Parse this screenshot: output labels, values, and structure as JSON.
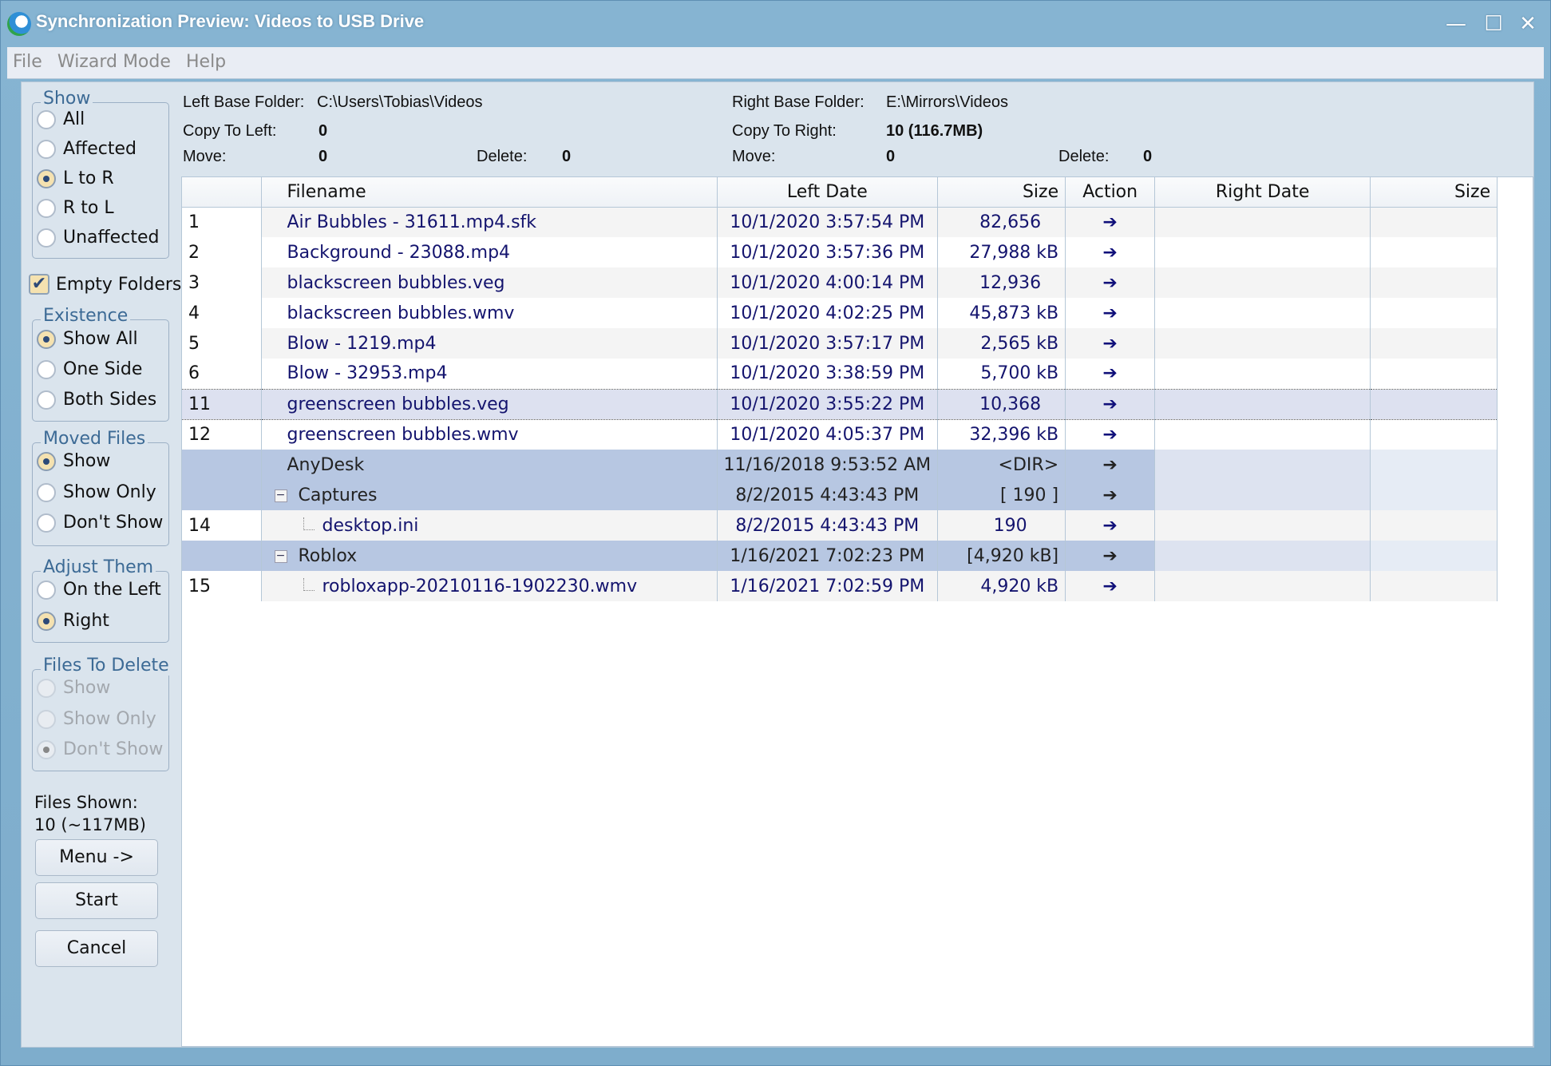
{
  "window": {
    "title": "Synchronization Preview: Videos to USB Drive",
    "minimize": "—",
    "maximize": "☐",
    "close": "✕"
  },
  "menu": [
    "File",
    "Wizard Mode",
    "Help"
  ],
  "left_panel": {
    "show": {
      "title": "Show",
      "options": [
        {
          "label": "All",
          "selected": false
        },
        {
          "label": "Affected",
          "selected": false
        },
        {
          "label": "L to R",
          "selected": true
        },
        {
          "label": "R to L",
          "selected": false
        },
        {
          "label": "Unaffected",
          "selected": false
        }
      ]
    },
    "empty_folders": {
      "label": "Empty Folders",
      "checked": true,
      "glyph": "✔"
    },
    "existence": {
      "title": "Existence",
      "options": [
        {
          "label": "Show All",
          "selected": true
        },
        {
          "label": "One Side",
          "selected": false
        },
        {
          "label": "Both Sides",
          "selected": false
        }
      ]
    },
    "moved_files": {
      "title": "Moved Files",
      "options": [
        {
          "label": "Show",
          "selected": true
        },
        {
          "label": "Show Only",
          "selected": false
        },
        {
          "label": "Don't Show",
          "selected": false
        }
      ]
    },
    "adjust_them": {
      "title": "Adjust Them",
      "options": [
        {
          "label": "On the Left",
          "selected": false
        },
        {
          "label": "Right",
          "selected": true
        }
      ]
    },
    "files_to_delete": {
      "title": "Files To Delete",
      "disabled": true,
      "options": [
        {
          "label": "Show",
          "selected": false
        },
        {
          "label": "Show Only",
          "selected": false
        },
        {
          "label": "Don't Show",
          "selected": true
        }
      ]
    },
    "files_shown_label": "Files Shown:",
    "files_shown_value": "10 (~117MB)",
    "buttons": {
      "menu": "Menu ->",
      "start": "Start",
      "cancel": "Cancel"
    }
  },
  "summary": {
    "left_base_label": "Left Base Folder:",
    "left_base": "C:\\Users\\Tobias\\Videos",
    "right_base_label": "Right Base Folder:",
    "right_base": "E:\\Mirrors\\Videos",
    "copy_left_label": "Copy To Left:",
    "copy_left": "0",
    "copy_right_label": "Copy To Right:",
    "copy_right": "10 (116.7MB)",
    "move_label": "Move:",
    "left_move": "0",
    "right_move": "0",
    "delete_label": "Delete:",
    "left_delete": "0",
    "right_delete": "0"
  },
  "table": {
    "columns": [
      "",
      "Filename",
      "Left Date",
      "Size",
      "Action",
      "Right Date",
      "Size"
    ],
    "action_glyph": "➔",
    "rows": [
      {
        "num": "1",
        "name": "Air Bubbles - 31611.mp4.sfk",
        "left_date": "10/1/2020 3:57:54 PM",
        "size": "82,656",
        "action": "copy-right"
      },
      {
        "num": "2",
        "name": "Background - 23088.mp4",
        "left_date": "10/1/2020 3:57:36 PM",
        "size": "27,988 kB",
        "action": "copy-right"
      },
      {
        "num": "3",
        "name": "blackscreen bubbles.veg",
        "left_date": "10/1/2020 4:00:14 PM",
        "size": "12,936",
        "action": "copy-right"
      },
      {
        "num": "4",
        "name": "blackscreen bubbles.wmv",
        "left_date": "10/1/2020 4:02:25 PM",
        "size": "45,873 kB",
        "action": "copy-right"
      },
      {
        "num": "5",
        "name": "Blow - 1219.mp4",
        "left_date": "10/1/2020 3:57:17 PM",
        "size": "2,565 kB",
        "action": "copy-right"
      },
      {
        "num": "6",
        "name": "Blow - 32953.mp4",
        "left_date": "10/1/2020 3:38:59 PM",
        "size": "5,700 kB",
        "action": "copy-right"
      },
      {
        "num": "11",
        "name": "greenscreen bubbles.veg",
        "left_date": "10/1/2020 3:55:22 PM",
        "size": "10,368",
        "action": "copy-right",
        "selected": true
      },
      {
        "num": "12",
        "name": "greenscreen bubbles.wmv",
        "left_date": "10/1/2020 4:05:37 PM",
        "size": "32,396 kB",
        "action": "copy-right"
      },
      {
        "num": "",
        "name": "AnyDesk",
        "left_date": "11/16/2018 9:53:52 AM",
        "size": "<DIR>",
        "action": "copy-right",
        "folder": true
      },
      {
        "num": "",
        "name": "Captures",
        "left_date": "8/2/2015 4:43:43 PM",
        "size": "[ 190  ]",
        "action": "copy-right",
        "folder": true,
        "expander": "−"
      },
      {
        "num": "14",
        "name": "desktop.ini",
        "left_date": "8/2/2015 4:43:43 PM",
        "size": "190",
        "action": "copy-right",
        "child": true
      },
      {
        "num": "",
        "name": "Roblox",
        "left_date": "1/16/2021 7:02:23 PM",
        "size": "[4,920 kB]",
        "action": "copy-right",
        "folder": true,
        "expander": "−"
      },
      {
        "num": "15",
        "name": "robloxapp-20210116-1902230.wmv",
        "left_date": "1/16/2021 7:02:59 PM",
        "size": "4,920 kB",
        "action": "copy-right",
        "child": true
      }
    ]
  }
}
